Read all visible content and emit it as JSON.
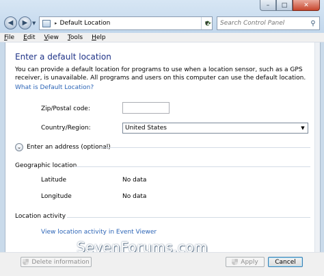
{
  "window": {
    "controls": {
      "minimize": "–",
      "maximize": "□",
      "close": "✕"
    }
  },
  "address_bar": {
    "separator": "▸",
    "path": "Default Location"
  },
  "search": {
    "placeholder": "Search Control Panel"
  },
  "menu": {
    "items": [
      {
        "label": "File",
        "accel": "F"
      },
      {
        "label": "Edit",
        "accel": "E"
      },
      {
        "label": "View",
        "accel": "V"
      },
      {
        "label": "Tools",
        "accel": "T"
      },
      {
        "label": "Help",
        "accel": "H"
      }
    ]
  },
  "content": {
    "title": "Enter a default location",
    "description": "You can provide a default location for programs to use when a location sensor, such as a GPS receiver, is unavailable. All programs and users on this computer can use the default location.",
    "what_link": "What is Default Location?",
    "zip_label": "Zip/Postal code:",
    "zip_value": "",
    "country_label": "Country/Region:",
    "country_value": "United States",
    "expander_label": "Enter an address (optional)",
    "geo_heading": "Geographic location",
    "latitude_label": "Latitude",
    "latitude_value": "No data",
    "longitude_label": "Longitude",
    "longitude_value": "No data",
    "activity_heading": "Location activity",
    "activity_link": "View location activity in Event Viewer"
  },
  "watermark": "SevenForums.com",
  "footer": {
    "delete_label": "Delete information",
    "apply_label": "Apply",
    "cancel_label": "Cancel"
  }
}
